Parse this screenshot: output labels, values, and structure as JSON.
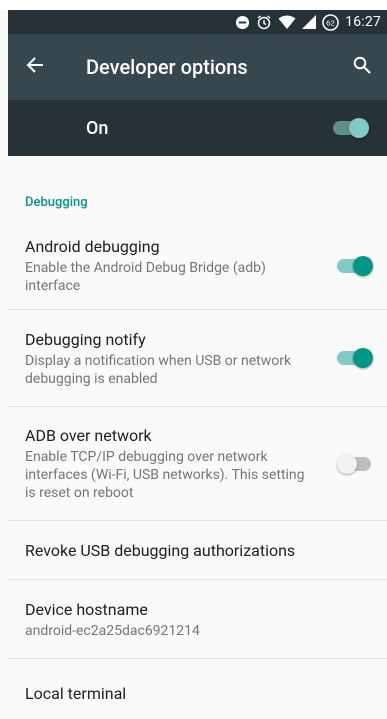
{
  "status_bar": {
    "time": "16:27",
    "battery_level": "62",
    "icons": [
      "do-not-disturb-icon",
      "alarm-icon",
      "wifi-icon",
      "signal-icon",
      "battery-icon"
    ]
  },
  "app_bar": {
    "title": "Developer options",
    "back_icon": "arrow-back-icon",
    "search_icon": "search-icon"
  },
  "master_switch": {
    "label": "On",
    "checked": true
  },
  "debugging": {
    "category_title": "Debugging",
    "items": [
      {
        "title": "Android debugging",
        "summary": "Enable the Android Debug Bridge (adb) interface",
        "checked": true
      },
      {
        "title": "Debugging notify",
        "summary": "Display a notification when USB or network debugging is enabled",
        "checked": true
      },
      {
        "title": "ADB over network",
        "summary": "Enable TCP/IP debugging over network interfaces (Wi-Fi, USB networks). This setting is reset on reboot",
        "checked": false
      },
      {
        "title": "Revoke USB debugging authorizations"
      },
      {
        "title": "Device hostname",
        "summary": "android-ec2a25dac6921214"
      },
      {
        "title": "Local terminal"
      }
    ]
  },
  "colors": {
    "accent": "#009688",
    "app_bar": "#37474f",
    "status_bar": "#263238"
  }
}
